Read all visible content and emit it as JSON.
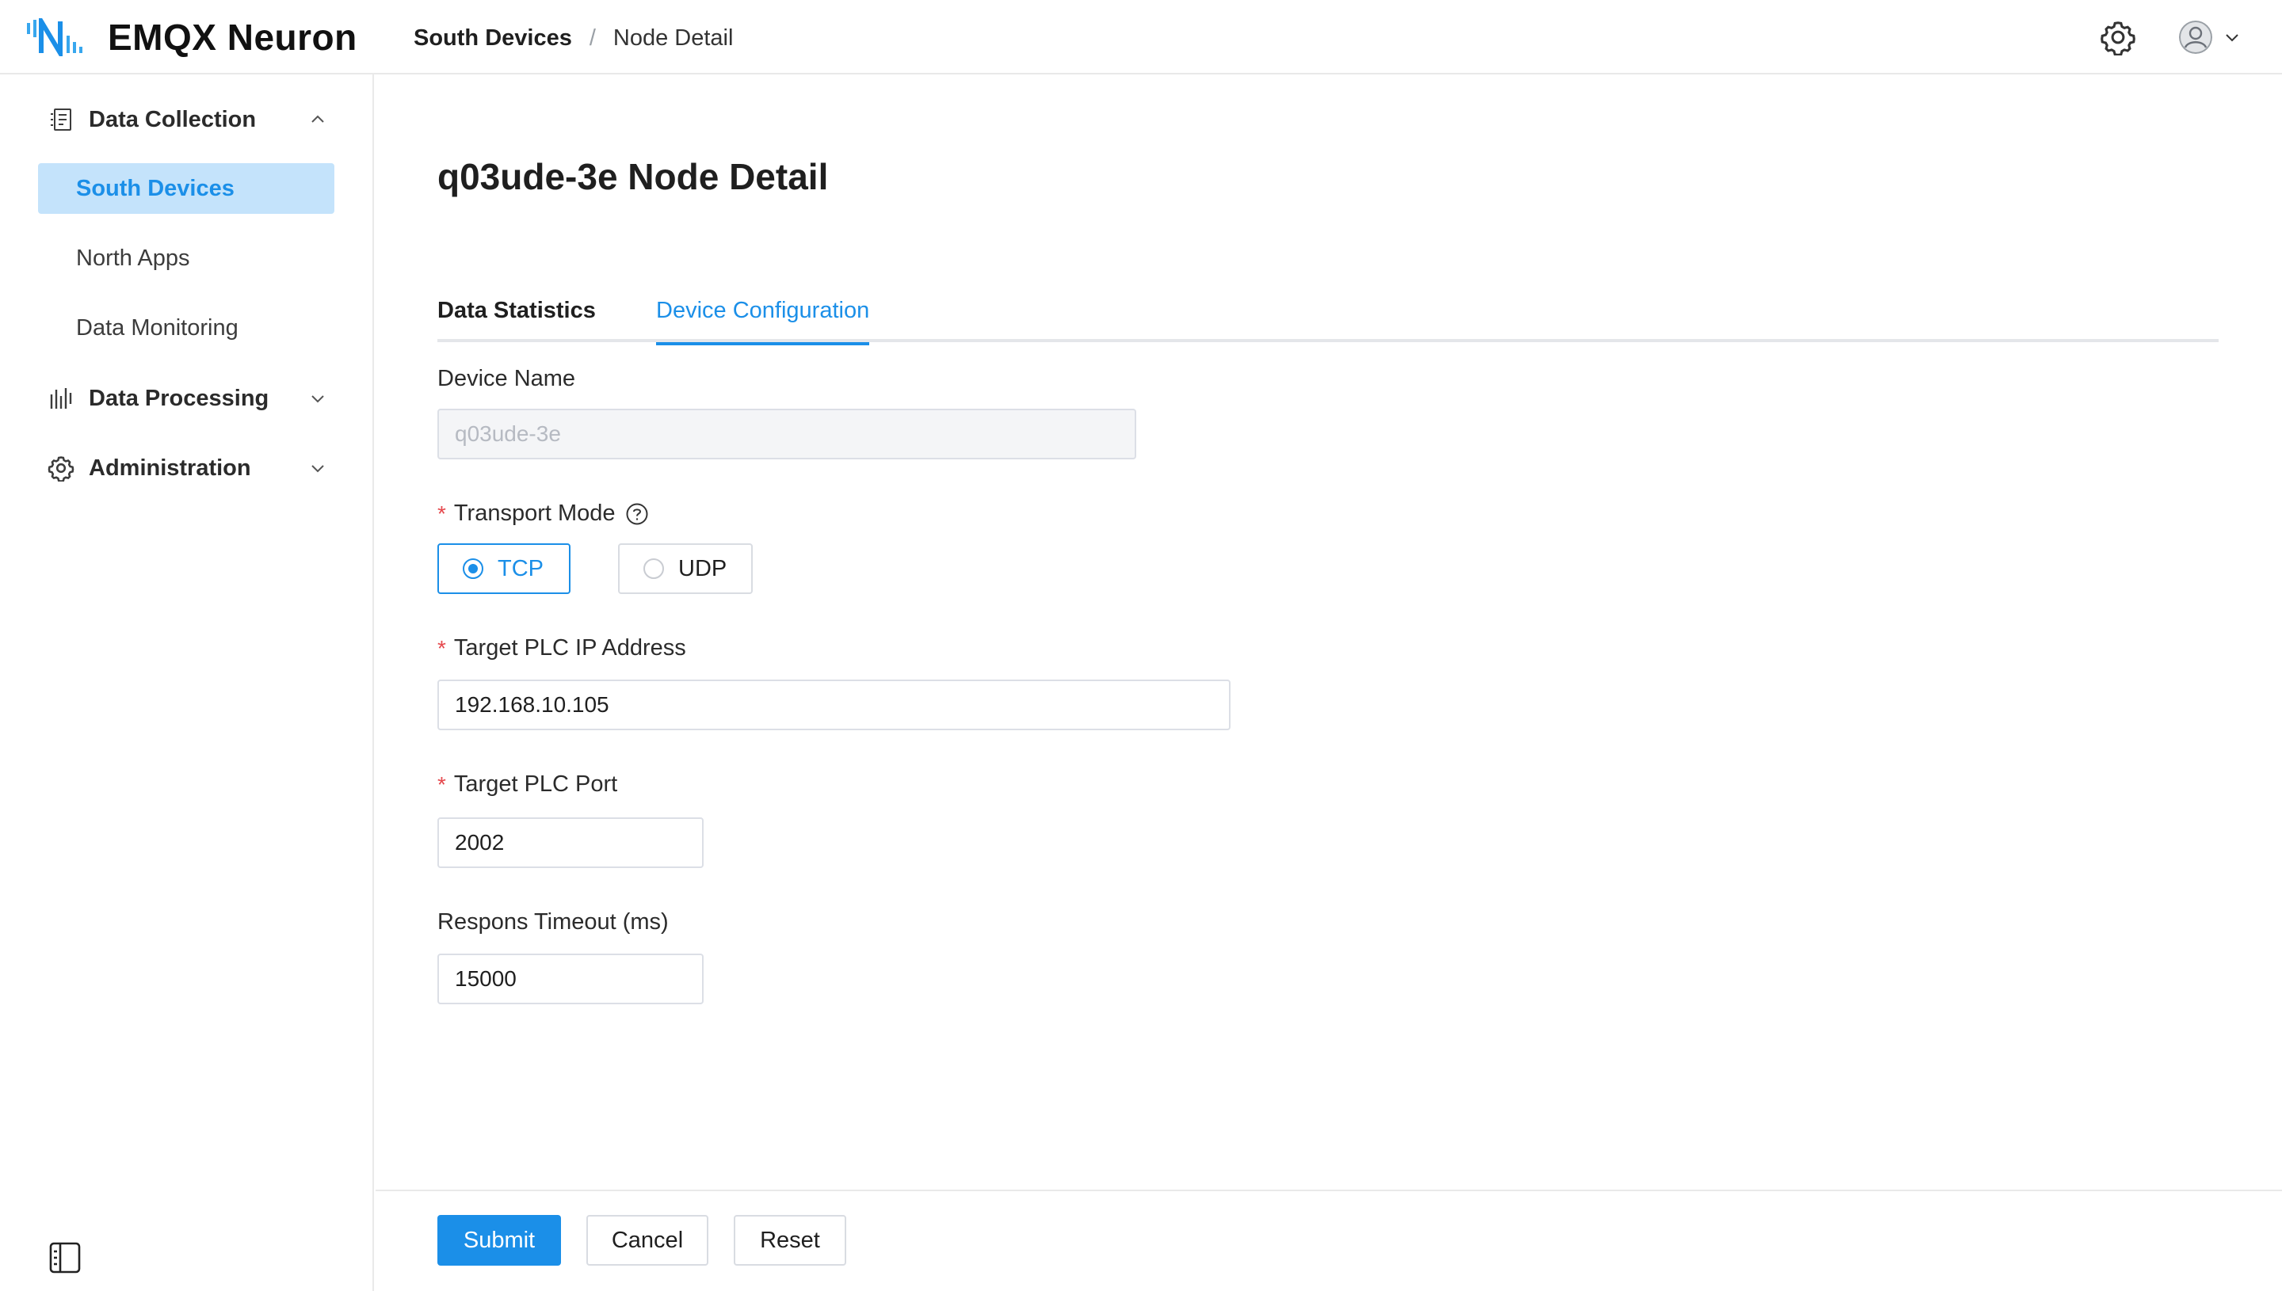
{
  "app": {
    "title": "EMQX Neuron",
    "accent": "#1b8fe8"
  },
  "header": {
    "breadcrumb": {
      "parent": "South Devices",
      "separator": "/",
      "current": "Node Detail"
    },
    "settings_icon": "gear-icon",
    "user_icon": "user-avatar-icon"
  },
  "sidebar": {
    "groups": [
      {
        "label": "Data Collection",
        "icon": "list-icon",
        "expanded": true
      },
      {
        "label": "Data Processing",
        "icon": "bars-icon",
        "expanded": false
      },
      {
        "label": "Administration",
        "icon": "gear-icon",
        "expanded": false
      }
    ],
    "items": [
      {
        "label": "South Devices",
        "active": true
      },
      {
        "label": "North Apps",
        "active": false
      },
      {
        "label": "Data Monitoring",
        "active": false
      }
    ]
  },
  "main": {
    "title": "q03ude-3e Node Detail",
    "tabs": [
      {
        "label": "Data Statistics",
        "active": false
      },
      {
        "label": "Device Configuration",
        "active": true
      }
    ],
    "form": {
      "device_name": {
        "label": "Device Name",
        "value": "q03ude-3e"
      },
      "transport_mode": {
        "label": "Transport Mode",
        "required": "*",
        "options": [
          "TCP",
          "UDP"
        ],
        "selected": "TCP"
      },
      "ip_address": {
        "label": "Target PLC IP Address",
        "required": "*",
        "value": "192.168.10.105"
      },
      "port": {
        "label": "Target PLC Port",
        "required": "*",
        "value": "2002"
      },
      "timeout": {
        "label": "Respons Timeout (ms)",
        "value": "15000"
      }
    },
    "buttons": {
      "submit": "Submit",
      "cancel": "Cancel",
      "reset": "Reset"
    }
  }
}
